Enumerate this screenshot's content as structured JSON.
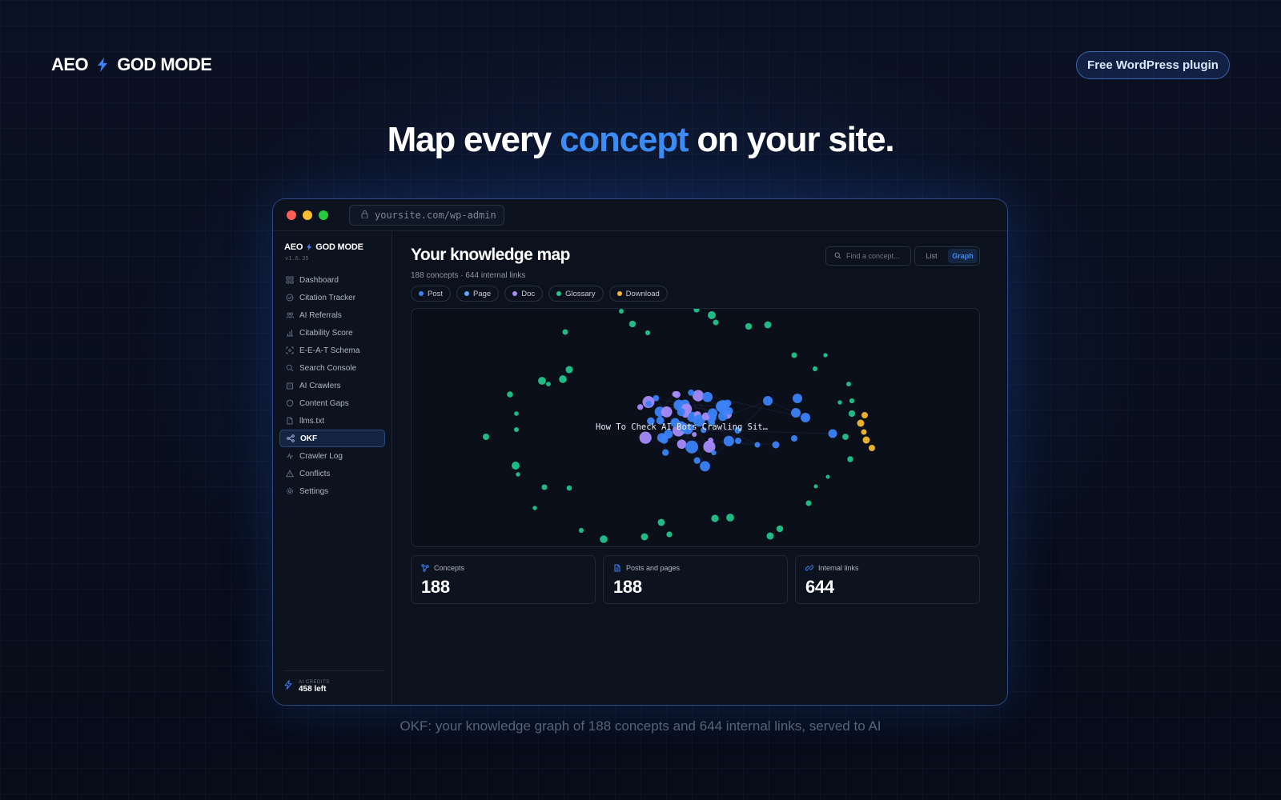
{
  "brand": {
    "name_left": "AEO",
    "name_right": "GOD MODE",
    "icon": "lightning-bolt-icon"
  },
  "cta": {
    "label": "Free WordPress plugin"
  },
  "headline": {
    "before": "Map every ",
    "accent": "concept",
    "after": " on your site."
  },
  "window": {
    "url": "yoursite.com/wp-admin"
  },
  "sidebar": {
    "brand_left": "AEO",
    "brand_right": "GOD MODE",
    "version": "v1.6.35",
    "items": [
      {
        "label": "Dashboard",
        "icon": "grid-icon"
      },
      {
        "label": "Citation Tracker",
        "icon": "check-circle-icon"
      },
      {
        "label": "AI Referrals",
        "icon": "users-icon"
      },
      {
        "label": "Citability Score",
        "icon": "bar-chart-icon"
      },
      {
        "label": "E-E-A-T Schema",
        "icon": "scan-icon"
      },
      {
        "label": "Search Console",
        "icon": "search-icon"
      },
      {
        "label": "AI Crawlers",
        "icon": "building-icon"
      },
      {
        "label": "Content Gaps",
        "icon": "shield-icon"
      },
      {
        "label": "llms.txt",
        "icon": "file-icon"
      },
      {
        "label": "OKF",
        "icon": "share-icon",
        "active": true
      },
      {
        "label": "Crawler Log",
        "icon": "activity-icon"
      },
      {
        "label": "Conflicts",
        "icon": "warning-icon"
      },
      {
        "label": "Settings",
        "icon": "gear-icon"
      }
    ],
    "credits_label": "AI CREDITS",
    "credits_value": "458 left"
  },
  "main": {
    "title": "Your knowledge map",
    "subtitle": "188 concepts · 644 internal links",
    "search_placeholder": "Find a concept...",
    "view_toggle": {
      "list": "List",
      "graph": "Graph",
      "selected": "Graph"
    },
    "filters": [
      {
        "label": "Post",
        "color": "#3b82f6"
      },
      {
        "label": "Page",
        "color": "#60a5fa"
      },
      {
        "label": "Doc",
        "color": "#a78bfa"
      },
      {
        "label": "Glossary",
        "color": "#22c58b"
      },
      {
        "label": "Download",
        "color": "#f5b82e"
      }
    ],
    "hover_label": "How To Check AI Bots Crawling Sit…",
    "stats": [
      {
        "label": "Concepts",
        "value": "188",
        "icon": "concepts-icon"
      },
      {
        "label": "Posts and pages",
        "value": "188",
        "icon": "document-icon"
      },
      {
        "label": "Internal links",
        "value": "644",
        "icon": "link-icon"
      }
    ]
  },
  "caption": "OKF: your knowledge graph of 188 concepts and 644 internal links, served to AI",
  "colors": {
    "accent": "#3b8cf7",
    "post": "#3b82f6",
    "doc": "#a78bfa",
    "glossary": "#22c58b",
    "download": "#f5b82e"
  }
}
